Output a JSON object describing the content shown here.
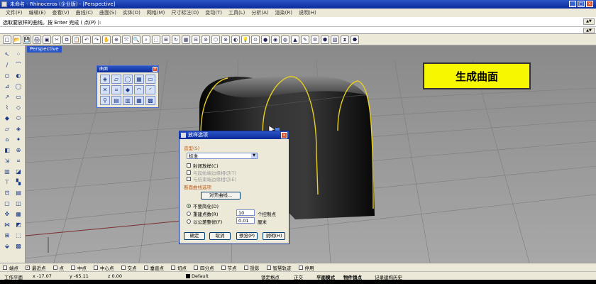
{
  "window": {
    "title": "未命名 - Rhinoceros (企业版) - [Perspective]",
    "buttons": [
      "_",
      "□",
      "×"
    ]
  },
  "menu": [
    "文件(F)",
    "编辑(E)",
    "查看(V)",
    "曲线(C)",
    "曲面(S)",
    "实体(O)",
    "网格(M)",
    "尺寸标注(D)",
    "变动(T)",
    "工具(L)",
    "分析(A)",
    "渲染(R)",
    "说明(H)"
  ],
  "command": {
    "prompt": "选取要放样的曲线。按 Enter 完成 ( 点(P) ):",
    "scroll_up": "▲▼",
    "scroll_down": "▲▼"
  },
  "toolbar_icons": [
    "□",
    "📂",
    "💾",
    "🖨",
    "▣",
    "✂",
    "⧉",
    "📋",
    "↶",
    "↷",
    "✋",
    "⊕",
    "⤧",
    "🔍",
    "⌕",
    "⬚",
    "⊞",
    "↻",
    "▦",
    "⊟",
    "⊚",
    "⬡",
    "⊗",
    "◐",
    "💡",
    "⊙",
    "●",
    "◉",
    "◍",
    "▲",
    "✎",
    "⚙",
    "⬢",
    "▧",
    "⧗",
    "⬣"
  ],
  "left_tools": [
    "↖",
    "⁘",
    "∕",
    "⌒",
    "○",
    "◐",
    "⊿",
    "◯",
    "↗",
    "▭",
    "⌇",
    "◇",
    "◆",
    "⬭",
    "▱",
    "◈",
    "⌂",
    "✦",
    "◧",
    "⊕",
    "⇲",
    "⌗",
    "▥",
    "◪",
    "⊤",
    "▚",
    "⊡",
    "▤",
    "▢",
    "◫",
    "✜",
    "▦",
    "⋈",
    "◩",
    "⊞",
    "⬚",
    "⬙",
    "▩"
  ],
  "viewport": {
    "label": "Perspective"
  },
  "banner": {
    "text": "生成曲面"
  },
  "palette": {
    "title": "曲面",
    "close": "×",
    "icons": [
      "◈",
      "▱",
      "◯",
      "▦",
      "▭",
      "✕",
      "⌗",
      "◆",
      "◠",
      "◜",
      "⚲",
      "▤",
      "▥",
      "▦",
      "▩"
    ]
  },
  "dialog": {
    "title": "放样选项",
    "close": "×",
    "style_section": "造型(S)",
    "style_value": "标准",
    "closed_loft": "封闭放样(C)",
    "match_start": "与起始端边缘相切(T)",
    "match_end": "与结束端边缘相切(E)",
    "cross_section": "断面曲线选项",
    "align_curves": "对齐曲线...",
    "no_simplify": "不要简化(D)",
    "rebuild": "重建点数(R)",
    "rebuild_value": "10",
    "rebuild_unit": "个控制点",
    "refit": "以公差整修(F)",
    "refit_value": "0.01",
    "refit_unit": "厘米",
    "ok": "确定",
    "cancel": "取消",
    "preview": "预览(P)",
    "help": "说明(H)"
  },
  "osnap": [
    "端点",
    "最近点",
    "点",
    "中点",
    "中心点",
    "交点",
    "垂直点",
    "切点",
    "四分点",
    "节点",
    "投影",
    "智慧轨迹",
    "停用"
  ],
  "osnap_checked": [
    false,
    true,
    false,
    false,
    false,
    false,
    false,
    false,
    false,
    false,
    false,
    false,
    false
  ],
  "status": {
    "cplane": "工作平面",
    "x": "x -17.07",
    "y": "y -65.11",
    "z": "z 0.00",
    "layer": "Default",
    "grid_snap": "锁定格点",
    "ortho": "正交",
    "planar": "平面模式",
    "obj_snap": "物件锁点",
    "history": "记录建构历史"
  }
}
